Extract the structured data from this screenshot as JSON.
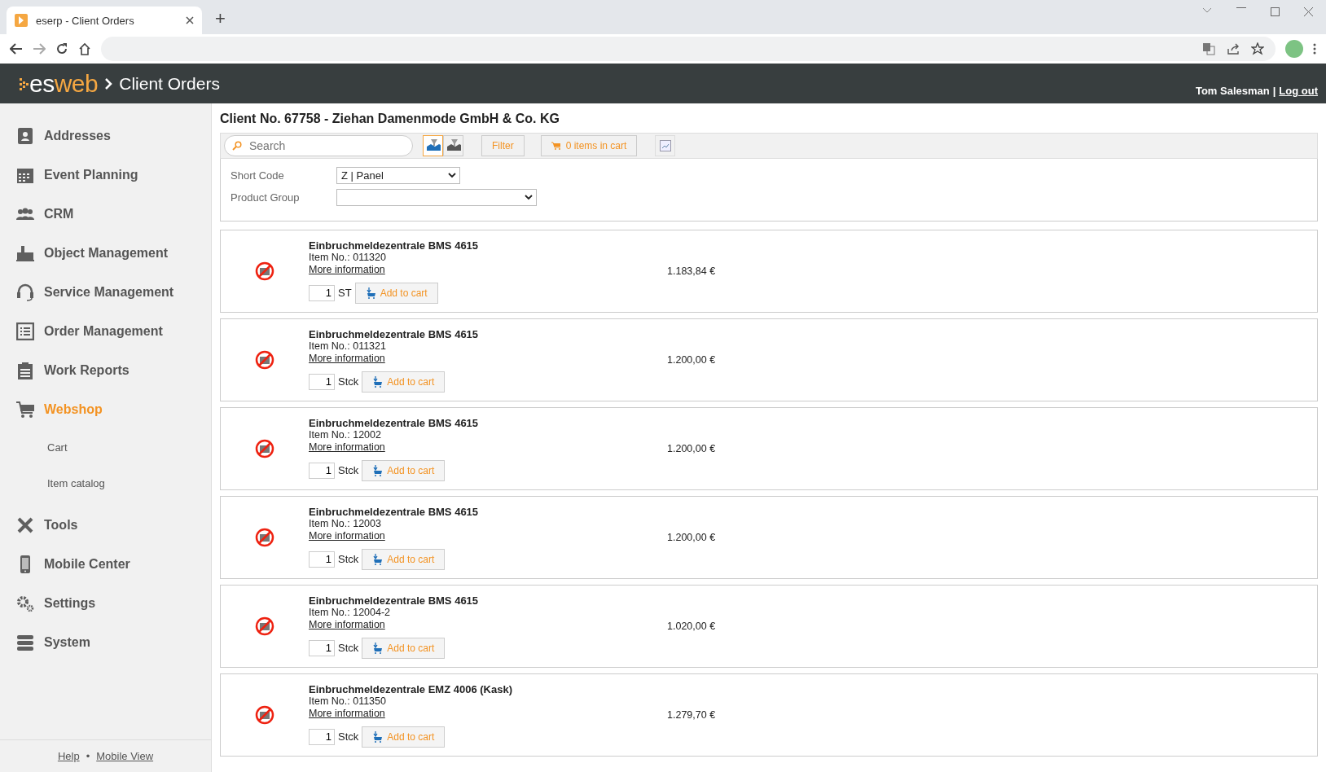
{
  "browser": {
    "tab_title": "eserp - Client Orders",
    "new_tab": "+"
  },
  "header": {
    "logo_prefix": "es",
    "logo_suffix": "web",
    "title": "Client Orders",
    "user": "Tom Salesman",
    "separator": "|",
    "logout": "Log out"
  },
  "sidebar": {
    "items": [
      {
        "label": "Addresses",
        "kind": "contact",
        "selected": false
      },
      {
        "label": "Event Planning",
        "kind": "calendar",
        "selected": false
      },
      {
        "label": "CRM",
        "kind": "people",
        "selected": false
      },
      {
        "label": "Object Management",
        "kind": "factory",
        "selected": false
      },
      {
        "label": "Service Management",
        "kind": "headset",
        "selected": false
      },
      {
        "label": "Order Management",
        "kind": "list",
        "selected": false
      },
      {
        "label": "Work Reports",
        "kind": "clipboard",
        "selected": false
      },
      {
        "label": "Webshop",
        "kind": "cart",
        "selected": true,
        "children": [
          {
            "label": "Cart"
          },
          {
            "label": "Item catalog"
          }
        ]
      },
      {
        "label": "Tools",
        "kind": "tools",
        "selected": false
      },
      {
        "label": "Mobile Center",
        "kind": "phone",
        "selected": false
      },
      {
        "label": "Settings",
        "kind": "gears",
        "selected": false
      },
      {
        "label": "System",
        "kind": "stack",
        "selected": false
      }
    ],
    "footer": {
      "help": "Help",
      "dot": "•",
      "mobile_view": "Mobile View"
    }
  },
  "content": {
    "title": "Client No. 67758 - Ziehan Damenmode GmbH & Co. KG",
    "search": {
      "placeholder": "Search"
    },
    "view_modes": [
      {
        "kind": "catalog",
        "selected": true
      },
      {
        "kind": "list",
        "selected": false
      }
    ],
    "filter": "Filter",
    "cart": "0 items in cart",
    "filters": [
      {
        "label": "Short Code",
        "value": "Z | Panel",
        "kind": "short"
      },
      {
        "label": "Product Group",
        "kind": "long"
      }
    ],
    "products": [
      {
        "name": "Einbruchmeldezentrale BMS 4615",
        "item_no": "Item No.: 011320",
        "more": "More information",
        "price": "1.183,84 €",
        "qty": "1",
        "unit": "ST",
        "add": "Add to cart"
      },
      {
        "name": "Einbruchmeldezentrale BMS 4615",
        "item_no": "Item No.: 011321",
        "more": "More information",
        "price": "1.200,00 €",
        "qty": "1",
        "unit": "Stck",
        "add": "Add to cart"
      },
      {
        "name": "Einbruchmeldezentrale BMS 4615",
        "item_no": "Item No.: 12002",
        "more": "More information",
        "price": "1.200,00 €",
        "qty": "1",
        "unit": "Stck",
        "add": "Add to cart"
      },
      {
        "name": "Einbruchmeldezentrale BMS 4615",
        "item_no": "Item No.: 12003",
        "more": "More information",
        "price": "1.200,00 €",
        "qty": "1",
        "unit": "Stck",
        "add": "Add to cart"
      },
      {
        "name": "Einbruchmeldezentrale BMS 4615",
        "item_no": "Item No.: 12004-2",
        "more": "More information",
        "price": "1.020,00 €",
        "qty": "1",
        "unit": "Stck",
        "add": "Add to cart"
      },
      {
        "name": "Einbruchmeldezentrale EMZ 4006 (Kask)",
        "item_no": "Item No.: 011350",
        "more": "More information",
        "price": "1.279,70 €",
        "qty": "1",
        "unit": "Stck",
        "add": "Add to cart"
      }
    ]
  }
}
